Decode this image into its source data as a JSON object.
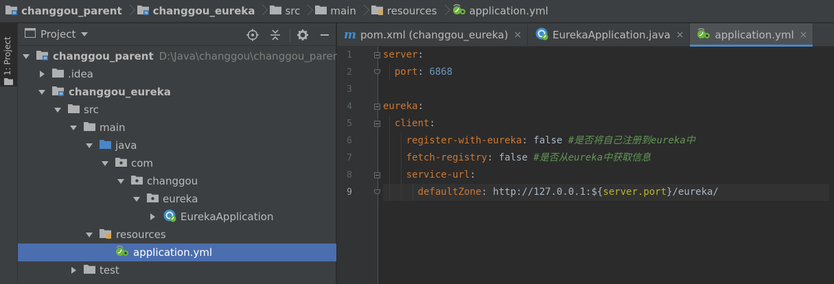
{
  "breadcrumb": [
    {
      "label": "changgou_parent",
      "icon": "module-folder-icon",
      "bold": true
    },
    {
      "label": "changgou_eureka",
      "icon": "module-folder-icon",
      "bold": true
    },
    {
      "label": "src",
      "icon": "folder-icon",
      "bold": false
    },
    {
      "label": "main",
      "icon": "folder-icon",
      "bold": false
    },
    {
      "label": "resources",
      "icon": "resources-folder-icon",
      "bold": false
    },
    {
      "label": "application.yml",
      "icon": "spring-yml-icon",
      "bold": false
    }
  ],
  "stripe": {
    "label": "1: Project"
  },
  "project_panel": {
    "title": "Project",
    "tree": [
      {
        "label": "changgou_parent",
        "path": "D:\\Java\\changgou\\changgou_paren",
        "depth": 0,
        "arrow": "down",
        "icon": "module-folder-icon",
        "bold": true
      },
      {
        "label": ".idea",
        "depth": 1,
        "arrow": "right",
        "icon": "folder-icon",
        "bold": false
      },
      {
        "label": "changgou_eureka",
        "depth": 1,
        "arrow": "down",
        "icon": "module-folder-icon",
        "bold": true
      },
      {
        "label": "src",
        "depth": 2,
        "arrow": "down",
        "icon": "folder-icon",
        "bold": false
      },
      {
        "label": "main",
        "depth": 3,
        "arrow": "down",
        "icon": "folder-icon",
        "bold": false
      },
      {
        "label": "java",
        "depth": 4,
        "arrow": "down",
        "icon": "source-folder-icon",
        "bold": false
      },
      {
        "label": "com",
        "depth": 5,
        "arrow": "down",
        "icon": "package-icon",
        "bold": false
      },
      {
        "label": "changgou",
        "depth": 6,
        "arrow": "down",
        "icon": "package-icon",
        "bold": false
      },
      {
        "label": "eureka",
        "depth": 7,
        "arrow": "down",
        "icon": "package-icon",
        "bold": false
      },
      {
        "label": "EurekaApplication",
        "depth": 8,
        "arrow": "right",
        "icon": "spring-class-icon",
        "bold": false
      },
      {
        "label": "resources",
        "depth": 4,
        "arrow": "down",
        "icon": "resources-folder-icon",
        "bold": false
      },
      {
        "label": "application.yml",
        "depth": 5,
        "arrow": "none",
        "icon": "spring-yml-icon",
        "bold": false,
        "selected": true
      },
      {
        "label": "test",
        "depth": 3,
        "arrow": "right",
        "icon": "folder-icon",
        "bold": false
      }
    ]
  },
  "editor": {
    "tabs": [
      {
        "label": "pom.xml (changgou_eureka)",
        "icon": "maven-icon",
        "active": false
      },
      {
        "label": "EurekaApplication.java",
        "icon": "spring-class-icon",
        "active": false
      },
      {
        "label": "application.yml",
        "icon": "spring-yml-icon",
        "active": true
      }
    ],
    "close_glyph": "×",
    "current_line": 9,
    "lines": [
      {
        "num": "1",
        "parts": [
          {
            "t": "server",
            "c": "k"
          },
          {
            "t": ":",
            "c": "p"
          }
        ]
      },
      {
        "num": "2",
        "parts": [
          {
            "t": "  ",
            "c": "p"
          },
          {
            "t": "port",
            "c": "k"
          },
          {
            "t": ": ",
            "c": "p"
          },
          {
            "t": "6868",
            "c": "n"
          }
        ]
      },
      {
        "num": "3",
        "parts": []
      },
      {
        "num": "4",
        "parts": [
          {
            "t": "eureka",
            "c": "k"
          },
          {
            "t": ":",
            "c": "p"
          }
        ]
      },
      {
        "num": "5",
        "parts": [
          {
            "t": "  ",
            "c": "p"
          },
          {
            "t": "client",
            "c": "k"
          },
          {
            "t": ":",
            "c": "p"
          }
        ]
      },
      {
        "num": "6",
        "parts": [
          {
            "t": "    ",
            "c": "p"
          },
          {
            "t": "register-with-eureka",
            "c": "k"
          },
          {
            "t": ": ",
            "c": "p"
          },
          {
            "t": "false",
            "c": "v"
          },
          {
            "t": " #是否将自己注册到eureka中",
            "c": "c"
          }
        ]
      },
      {
        "num": "7",
        "parts": [
          {
            "t": "    ",
            "c": "p"
          },
          {
            "t": "fetch-registry",
            "c": "k"
          },
          {
            "t": ": ",
            "c": "p"
          },
          {
            "t": "false",
            "c": "v"
          },
          {
            "t": " #是否从eureka中获取信息",
            "c": "c"
          }
        ]
      },
      {
        "num": "8",
        "parts": [
          {
            "t": "    ",
            "c": "p"
          },
          {
            "t": "service-url",
            "c": "k"
          },
          {
            "t": ":",
            "c": "p"
          }
        ]
      },
      {
        "num": "9",
        "parts": [
          {
            "t": "      ",
            "c": "p"
          },
          {
            "t": "defaultZone",
            "c": "k"
          },
          {
            "t": ": ",
            "c": "p"
          },
          {
            "t": "http://127.0.0.1:",
            "c": "v"
          },
          {
            "t": "${",
            "c": "v"
          },
          {
            "t": "server.port",
            "c": "tmpl"
          },
          {
            "t": "}",
            "c": "v"
          },
          {
            "t": "/eureka/",
            "c": "v"
          }
        ]
      }
    ]
  },
  "colors": {
    "keyword": "#cc7832",
    "number": "#6897bb",
    "comment": "#629755",
    "template": "#bbb529",
    "selection": "#4b6eaf",
    "active_tab_underline": "#4a88c7"
  }
}
